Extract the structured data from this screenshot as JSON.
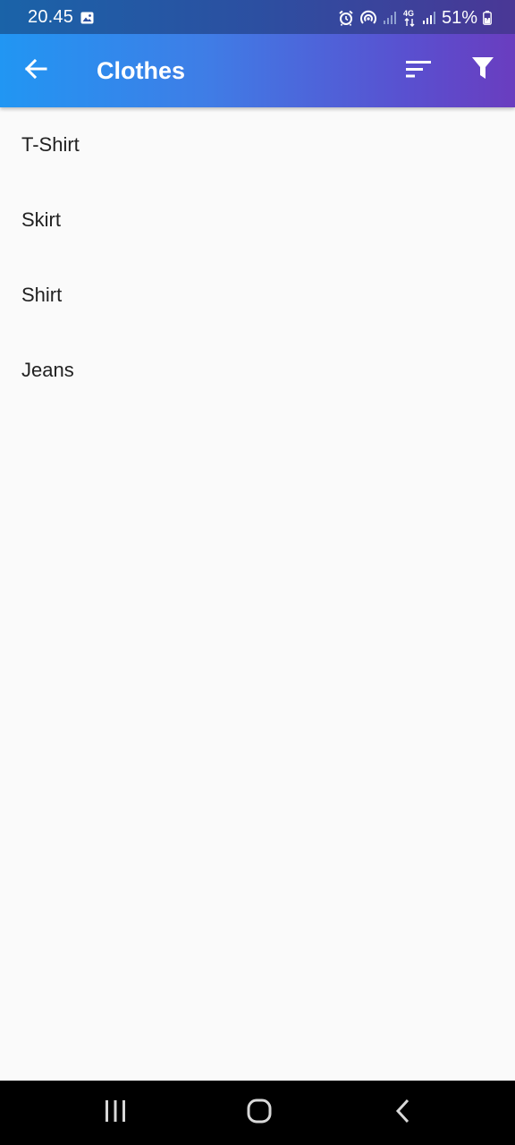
{
  "status_bar": {
    "time": "20.45",
    "network": "4G",
    "battery": "51%",
    "icons": [
      "gallery-icon",
      "alarm-icon",
      "hotspot-icon",
      "signal-icon",
      "network-4g-icon",
      "signal-icon",
      "battery-icon"
    ]
  },
  "app_bar": {
    "title": "Clothes",
    "back_icon": "arrow-back-icon",
    "sort_icon": "sort-icon",
    "filter_icon": "filter-icon",
    "gradient_start": "#2196f3",
    "gradient_end": "#6a3dbf"
  },
  "list": {
    "items": [
      {
        "label": "T-Shirt"
      },
      {
        "label": "Skirt"
      },
      {
        "label": "Shirt"
      },
      {
        "label": "Jeans"
      }
    ]
  },
  "nav_bar": {
    "icons": [
      "recents-icon",
      "home-icon",
      "back-icon"
    ]
  }
}
